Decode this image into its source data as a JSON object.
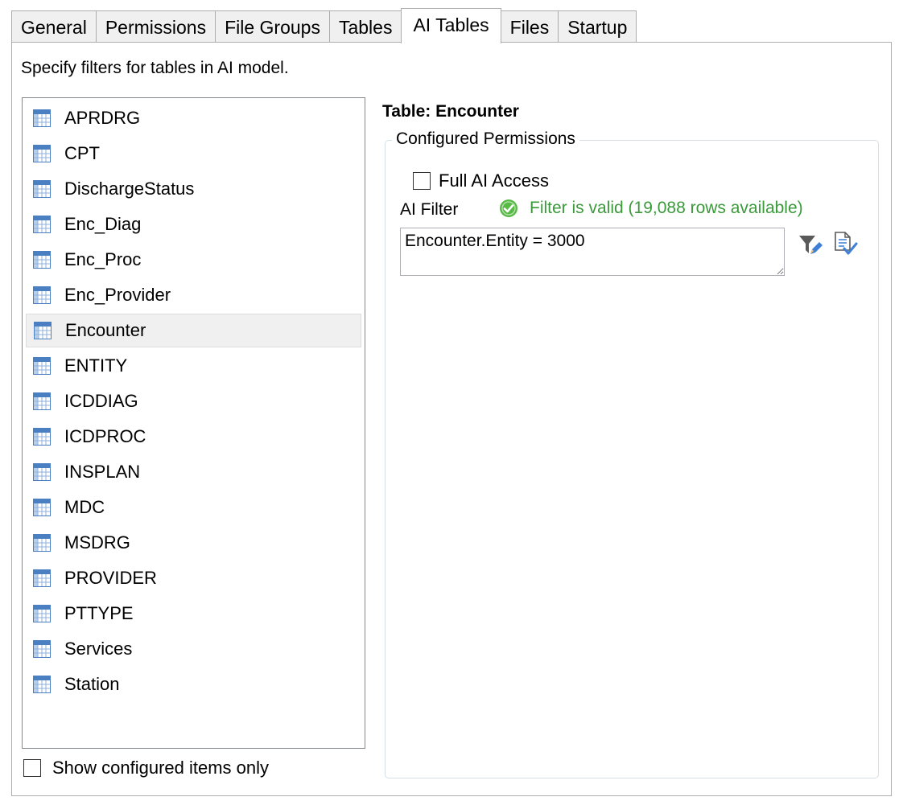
{
  "tabs": [
    {
      "label": "General",
      "active": false
    },
    {
      "label": "Permissions",
      "active": false
    },
    {
      "label": "File Groups",
      "active": false
    },
    {
      "label": "Tables",
      "active": false
    },
    {
      "label": "AI Tables",
      "active": true
    },
    {
      "label": "Files",
      "active": false
    },
    {
      "label": "Startup",
      "active": false
    }
  ],
  "description": "Specify filters for tables in AI model.",
  "tables": [
    {
      "name": "APRDRG",
      "icon": "table-icon"
    },
    {
      "name": "CPT",
      "icon": "table-icon"
    },
    {
      "name": "DischargeStatus",
      "icon": "table-icon"
    },
    {
      "name": "Enc_Diag",
      "icon": "table-icon"
    },
    {
      "name": "Enc_Proc",
      "icon": "table-icon"
    },
    {
      "name": "Enc_Provider",
      "icon": "table-icon"
    },
    {
      "name": "Encounter",
      "icon": "table-icon",
      "selected": true
    },
    {
      "name": "ENTITY",
      "icon": "table-icon"
    },
    {
      "name": "ICDDIAG",
      "icon": "table-icon"
    },
    {
      "name": "ICDPROC",
      "icon": "table-icon"
    },
    {
      "name": "INSPLAN",
      "icon": "table-icon"
    },
    {
      "name": "MDC",
      "icon": "table-icon"
    },
    {
      "name": "MSDRG",
      "icon": "table-icon"
    },
    {
      "name": "PROVIDER",
      "icon": "table-icon"
    },
    {
      "name": "PTTYPE",
      "icon": "table-icon"
    },
    {
      "name": "Services",
      "icon": "table-icon"
    },
    {
      "name": "Station",
      "icon": "table-icon"
    }
  ],
  "show_configured": {
    "label": "Show configured items only",
    "checked": false
  },
  "detail": {
    "table_title": "Table: Encounter",
    "group_label": "Configured Permissions",
    "full_access": {
      "label": "Full AI Access",
      "checked": false
    },
    "filter_label": "AI Filter",
    "validation": {
      "text": "Filter is valid (19,088 rows available)",
      "icon": "check-circle-icon",
      "color": "#3a9a3a"
    },
    "filter_value": "Encounter.Entity = 3000",
    "buttons": [
      {
        "icon": "edit-filter-icon"
      },
      {
        "icon": "validate-filter-icon"
      }
    ]
  }
}
